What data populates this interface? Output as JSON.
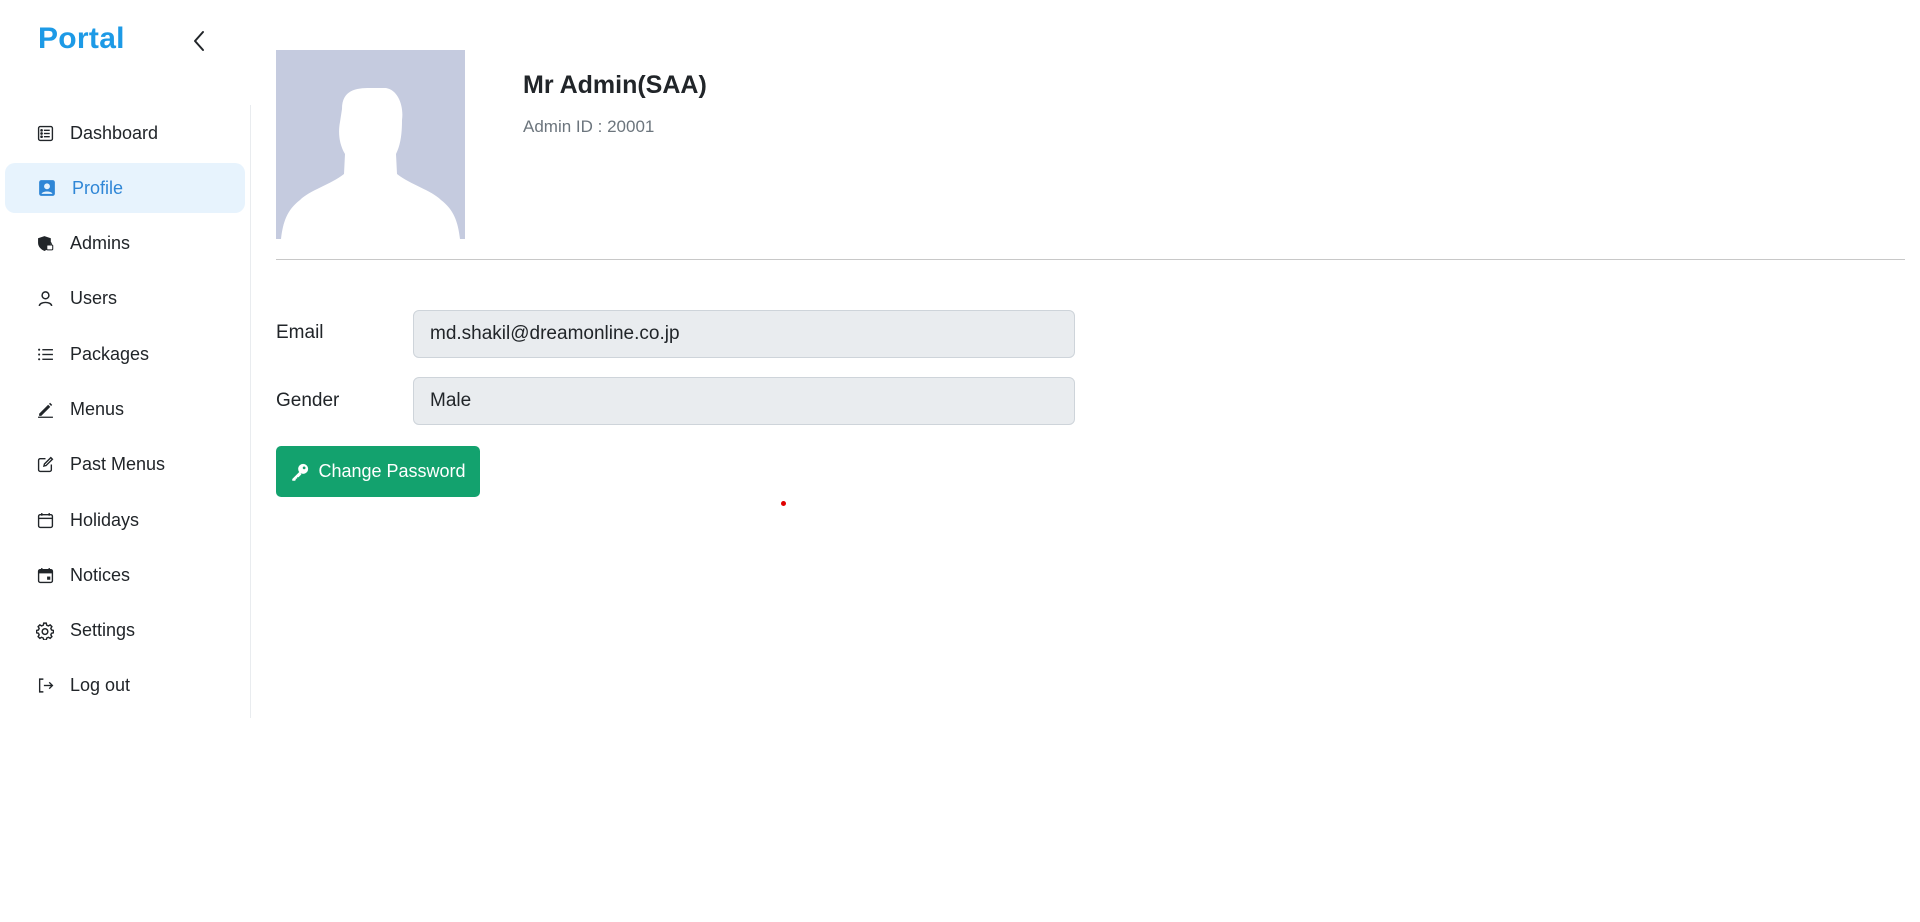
{
  "sidebar": {
    "brand": "Portal",
    "items": [
      {
        "label": "Dashboard",
        "icon": "list-alt-icon"
      },
      {
        "label": "Profile",
        "icon": "person-badge-icon",
        "active": true
      },
      {
        "label": "Admins",
        "icon": "shield-lock-icon"
      },
      {
        "label": "Users",
        "icon": "person-icon"
      },
      {
        "label": "Packages",
        "icon": "list-ul-icon"
      },
      {
        "label": "Menus",
        "icon": "pen-icon"
      },
      {
        "label": "Past Menus",
        "icon": "edit-square-icon"
      },
      {
        "label": "Holidays",
        "icon": "calendar-icon"
      },
      {
        "label": "Notices",
        "icon": "calendar-event-icon"
      },
      {
        "label": "Settings",
        "icon": "gear-icon"
      },
      {
        "label": "Log out",
        "icon": "logout-icon"
      }
    ]
  },
  "profile": {
    "name": "Mr Admin(SAA)",
    "admin_id": "Admin ID : 20001",
    "fields": {
      "email_label": "Email",
      "email_value": "md.shakil@dreamonline.co.jp",
      "gender_label": "Gender",
      "gender_value": "Male"
    },
    "change_password_label": "Change Password"
  },
  "colors": {
    "brand": "#1d9ae6",
    "active_nav_bg": "#e7f3fd",
    "active_nav_text": "#2f86d6",
    "button_green": "#13a26e",
    "avatar_bg": "#c5cbdf",
    "input_bg": "#e9ecef"
  }
}
